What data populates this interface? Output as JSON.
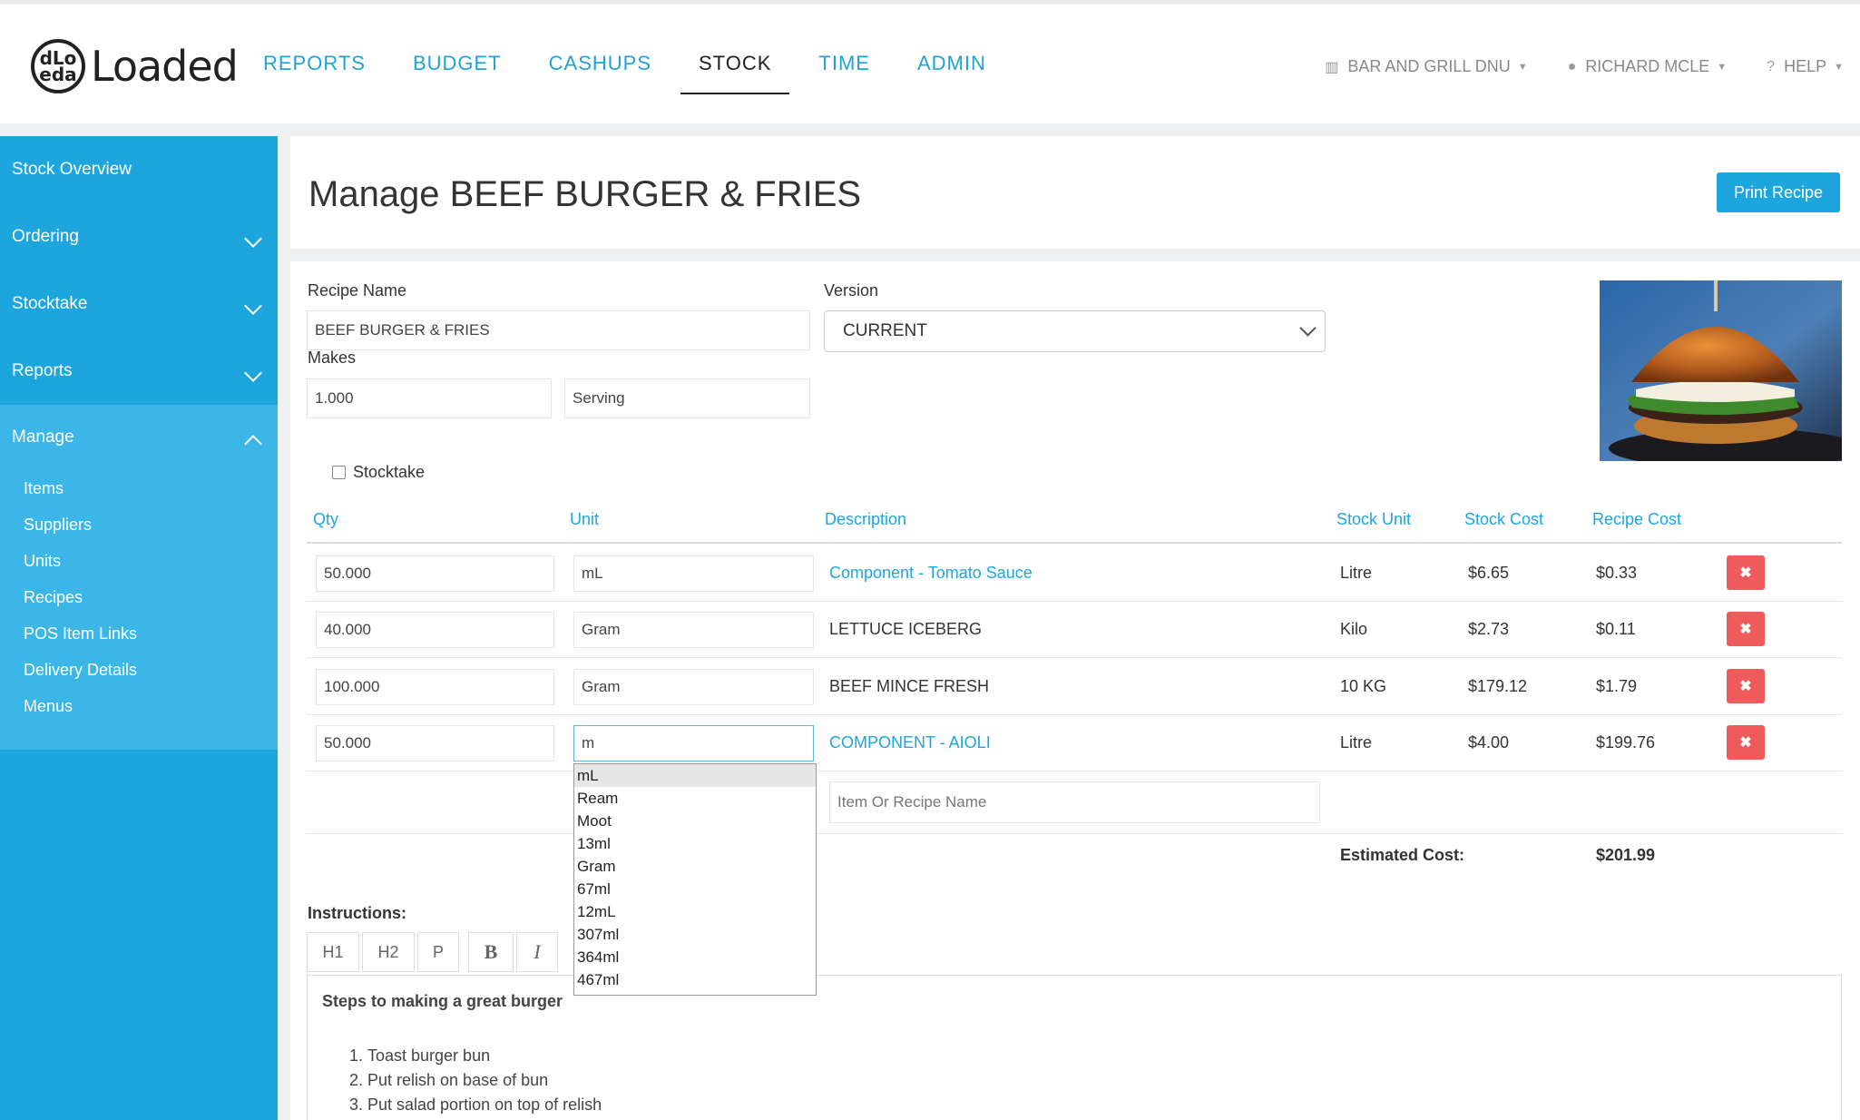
{
  "app": {
    "logo_text": "Loaded",
    "logo_mark": "dLo\neda"
  },
  "nav": {
    "items": [
      "REPORTS",
      "BUDGET",
      "CASHUPS",
      "STOCK",
      "TIME",
      "ADMIN"
    ],
    "active": "STOCK",
    "right": [
      {
        "icon": "building-icon",
        "label": "BAR AND GRILL DNU"
      },
      {
        "icon": "user-icon",
        "label": "RICHARD MCLE"
      },
      {
        "icon": "help-icon",
        "label": "HELP"
      }
    ]
  },
  "sidebar": {
    "items": [
      {
        "label": "Stock Overview"
      },
      {
        "label": "Ordering"
      },
      {
        "label": "Stocktake"
      },
      {
        "label": "Reports"
      },
      {
        "label": "Manage"
      }
    ],
    "manage_items": [
      "Items",
      "Suppliers",
      "Units",
      "Recipes",
      "POS Item Links",
      "Delivery Details",
      "Menus"
    ]
  },
  "page": {
    "title": "Manage BEEF BURGER & FRIES",
    "print_button": "Print Recipe"
  },
  "form": {
    "recipe_name_label": "Recipe Name",
    "recipe_name_value": "BEEF BURGER & FRIES",
    "version_label": "Version",
    "version_value": "CURRENT",
    "makes_label": "Makes",
    "makes_qty": "1.000",
    "makes_unit": "Serving",
    "stocktake_label": "Stocktake"
  },
  "table": {
    "headers": {
      "qty": "Qty",
      "unit": "Unit",
      "description": "Description",
      "stock_unit": "Stock Unit",
      "stock_cost": "Stock Cost",
      "recipe_cost": "Recipe Cost"
    },
    "rows": [
      {
        "qty": "50.000",
        "unit": "mL",
        "description": "Component - Tomato Sauce",
        "stock_unit": "Litre",
        "stock_cost": "$6.65",
        "recipe_cost": "$0.33"
      },
      {
        "qty": "40.000",
        "unit": "Gram",
        "description": "LETTUCE ICEBERG",
        "stock_unit": "Kilo",
        "stock_cost": "$2.73",
        "recipe_cost": "$0.11"
      },
      {
        "qty": "100.000",
        "unit": "Gram",
        "description": "BEEF MINCE FRESH",
        "stock_unit": "10 KG",
        "stock_cost": "$179.12",
        "recipe_cost": "$1.79"
      },
      {
        "qty": "50.000",
        "unit": "m",
        "description": "COMPONENT - AIOLI",
        "stock_unit": "Litre",
        "stock_cost": "$4.00",
        "recipe_cost": "$199.76"
      }
    ],
    "delete_symbol": "✖",
    "new_item_placeholder": "Item Or Recipe Name",
    "estimated_cost_label": "Estimated Cost:",
    "estimated_cost_value": "$201.99"
  },
  "unit_dropdown": {
    "options": [
      "mL",
      "Ream",
      "Moot",
      "13ml",
      "Gram",
      "67ml",
      "12mL",
      "307ml",
      "364ml",
      "467ml"
    ],
    "highlighted": "mL"
  },
  "instructions": {
    "label": "Instructions:",
    "toolbar": [
      "H1",
      "H2",
      "P",
      "B",
      "I"
    ],
    "heading": "Steps to making a great burger",
    "steps": [
      "Toast burger bun",
      "Put relish on base of bun",
      "Put salad portion on top of relish"
    ]
  },
  "colors": {
    "accent": "#1da6dd",
    "danger": "#ef5b5b",
    "sidebar": "#1da6dd"
  }
}
